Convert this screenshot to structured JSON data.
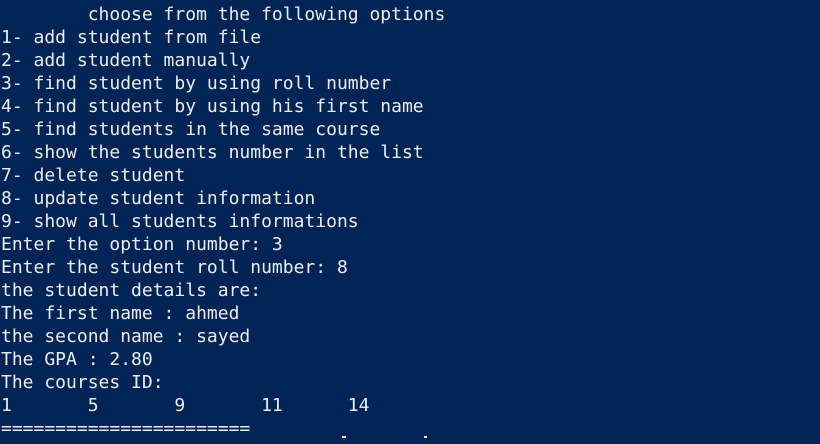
{
  "console": {
    "background": "#012456",
    "foreground": "#eeedf0",
    "lines": [
      "        choose from the following options",
      "1- add student from file",
      "2- add student manually",
      "3- find student by using roll number",
      "4- find student by using his first name",
      "5- find students in the same course",
      "6- show the students number in the list",
      "7- delete student",
      "8- update student information",
      "9- show all students informations",
      "Enter the option number: 3",
      "Enter the student roll number: 8",
      "the student details are:",
      "The first name : ahmed",
      "the second name : sayed",
      "The GPA : 2.80",
      "The courses ID:",
      "1       5       9       11      14",
      "======================="
    ]
  }
}
